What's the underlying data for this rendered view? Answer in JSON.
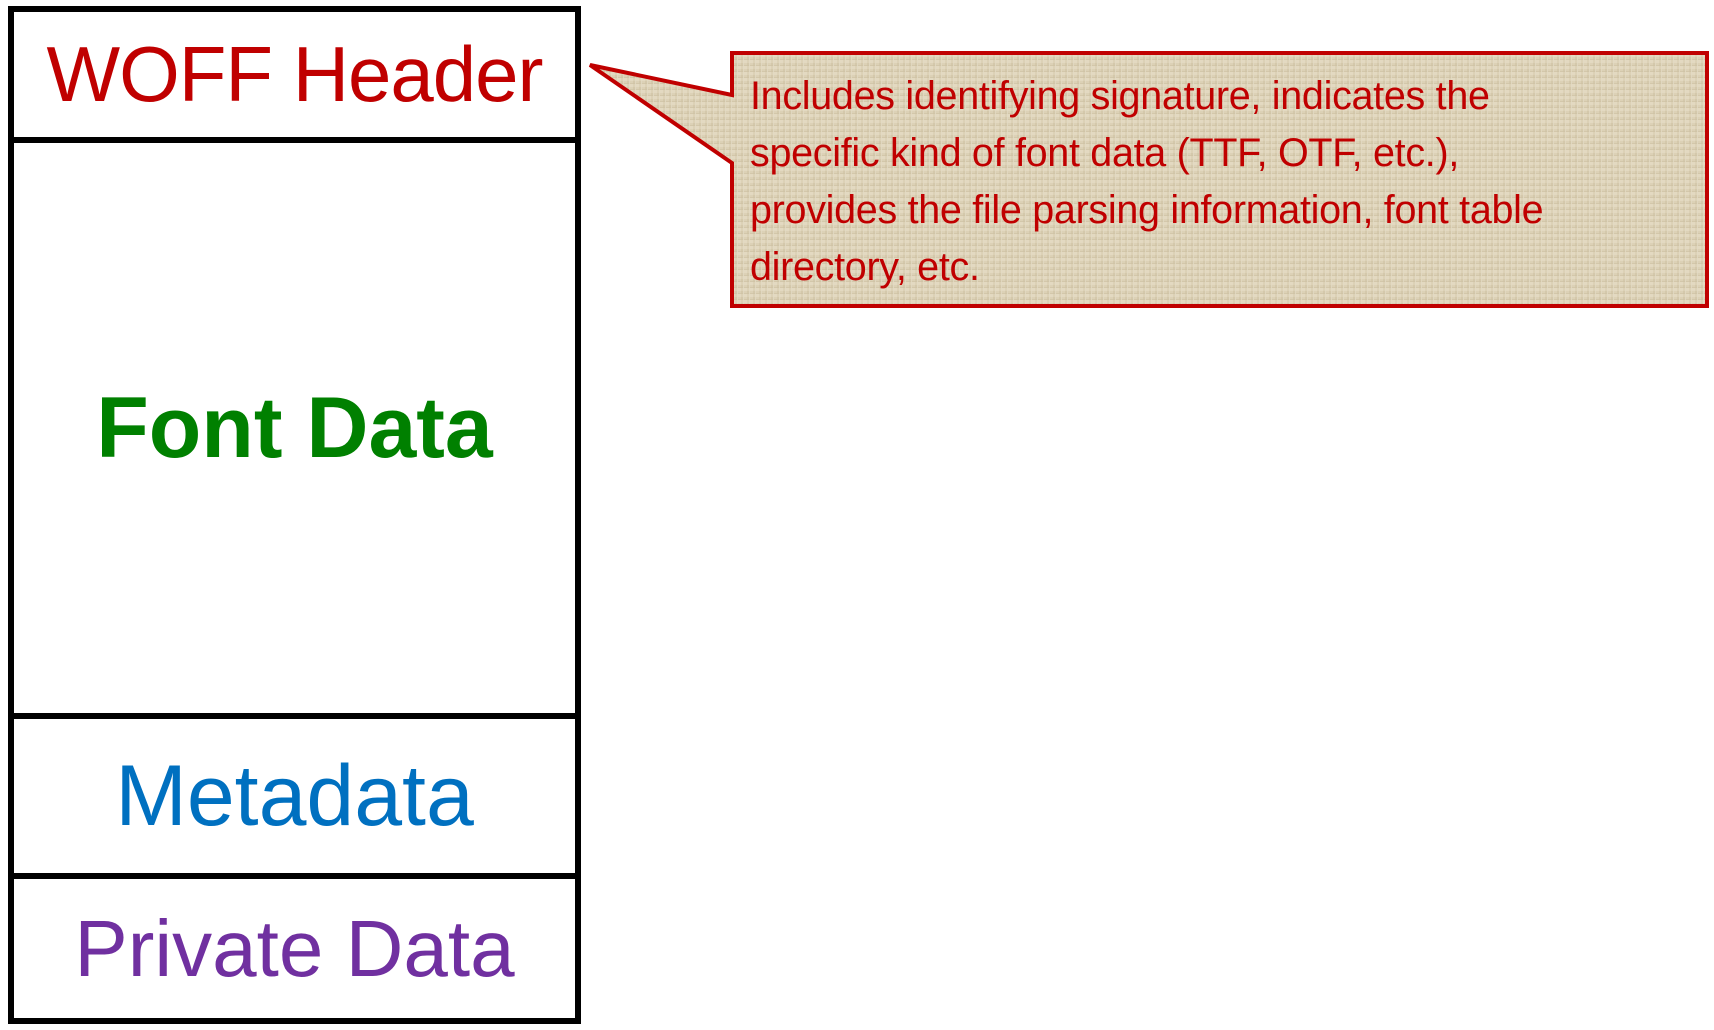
{
  "structure": {
    "segments": [
      {
        "label": "WOFF Header",
        "color": "#c00000"
      },
      {
        "label": "Font Data",
        "color": "#008000"
      },
      {
        "label": "Metadata",
        "color": "#0070c0"
      },
      {
        "label": "Private Data",
        "color": "#7030a0"
      }
    ]
  },
  "callout": {
    "text": "Includes identifying signature, indicates the\nspecific kind of font data (TTF, OTF, etc.),\nprovides the file parsing information, font table\ndirectory, etc.",
    "border_color": "#c00000",
    "fill_color": "#ddd2b8"
  }
}
